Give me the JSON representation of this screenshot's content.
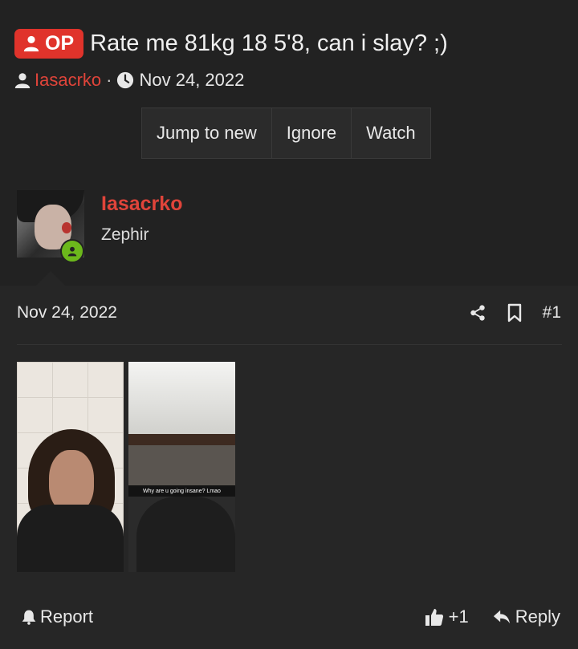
{
  "thread": {
    "op_badge": "OP",
    "title": "Rate me 81kg 18 5'8, can i slay? ;)",
    "author": "Iasacrko",
    "separator": "·",
    "date": "Nov 24, 2022"
  },
  "thread_buttons": {
    "jump_to_new": "Jump to new",
    "ignore": "Ignore",
    "watch": "Watch"
  },
  "post": {
    "username": "Iasacrko",
    "user_title": "Zephir",
    "date": "Nov 24, 2022",
    "number": "#1",
    "image2_caption": "Why are u going insane? Lmao",
    "report_label": "Report",
    "like_count": "+1",
    "reply_label": "Reply"
  },
  "colors": {
    "accent_red": "#e0332b",
    "username_red": "#e0443a",
    "online_green": "#6cb81c",
    "background": "#262626"
  },
  "icons": [
    "user-icon",
    "clock-icon",
    "share-icon",
    "bookmark-icon",
    "bell-icon",
    "thumbs-up-icon",
    "reply-icon"
  ]
}
